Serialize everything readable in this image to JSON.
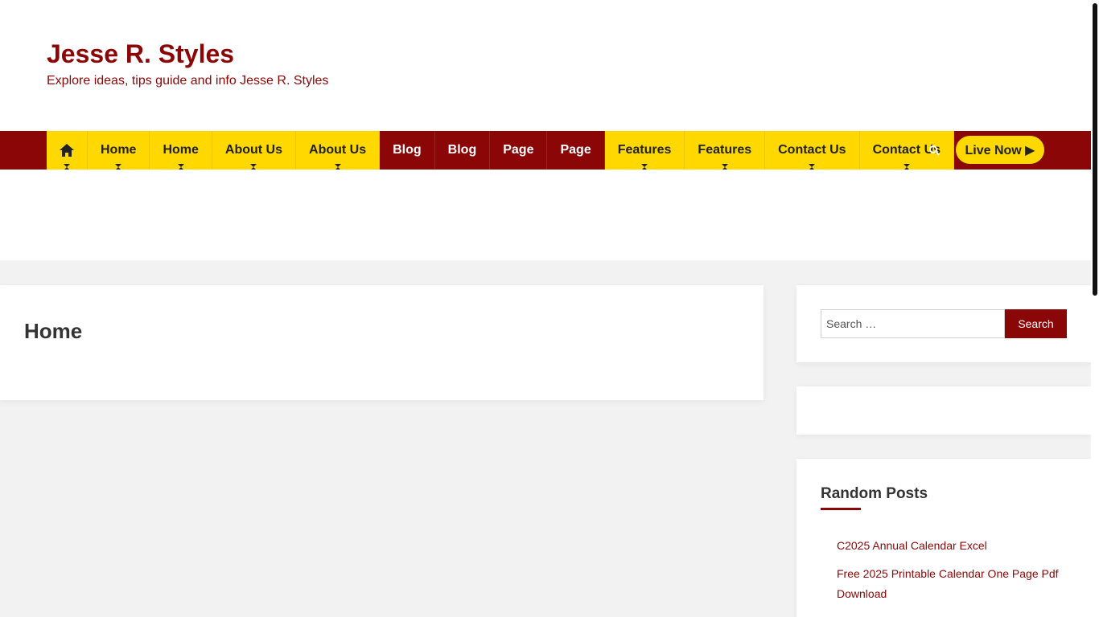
{
  "site": {
    "title": "Jesse R. Styles",
    "description": "Explore ideas, tips guide and info Jesse R. Styles"
  },
  "nav": {
    "home_icon": "home-icon",
    "items": [
      {
        "label": "Home",
        "style": "yellow",
        "submenu": true
      },
      {
        "label": "Home",
        "style": "yellow",
        "submenu": true
      },
      {
        "label": "About Us",
        "style": "yellow",
        "submenu": true
      },
      {
        "label": "About Us",
        "style": "yellow",
        "submenu": true
      },
      {
        "label": "Blog",
        "style": "red",
        "submenu": false
      },
      {
        "label": "Blog",
        "style": "red",
        "submenu": false
      },
      {
        "label": "Page",
        "style": "red",
        "submenu": false
      },
      {
        "label": "Page",
        "style": "red",
        "submenu": false
      },
      {
        "label": "Features",
        "style": "yellow",
        "submenu": true
      },
      {
        "label": "Features",
        "style": "yellow",
        "submenu": true
      },
      {
        "label": "Contact Us",
        "style": "yellow",
        "submenu": true
      },
      {
        "label": "Contact Us",
        "style": "yellow",
        "submenu": true
      }
    ],
    "search_icon": "search-icon",
    "live_button": "Live Now ▶"
  },
  "main": {
    "page_title": "Home"
  },
  "sidebar": {
    "search": {
      "placeholder": "Search …",
      "button_label": "Search"
    },
    "random_posts": {
      "title": "Random Posts",
      "items": [
        "C2025 Annual Calendar Excel",
        "Free 2025 Printable Calendar One Page Pdf Download"
      ]
    }
  },
  "colors": {
    "brand_red": "#8b0606",
    "accent_yellow": "#ffd800"
  }
}
